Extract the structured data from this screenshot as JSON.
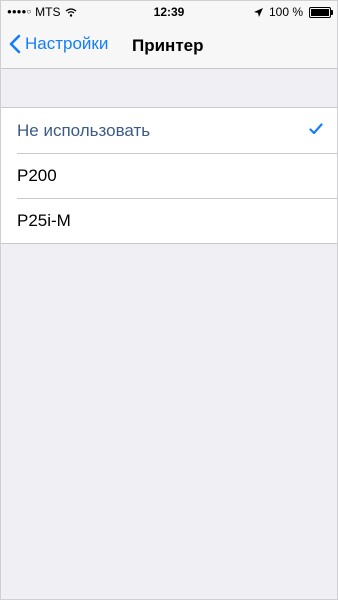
{
  "status_bar": {
    "carrier": "MTS",
    "time": "12:39",
    "battery_text": "100 %"
  },
  "nav": {
    "back_label": "Настройки",
    "title": "Принтер"
  },
  "printer_list": {
    "items": [
      {
        "label": "Не использовать",
        "selected": true
      },
      {
        "label": "P200",
        "selected": false
      },
      {
        "label": "P25i-M",
        "selected": false
      }
    ]
  },
  "colors": {
    "accent": "#147efb",
    "selected_text": "#3b5b85",
    "background": "#efeff4"
  },
  "icons": [
    "signal-dots-icon",
    "wifi-icon",
    "location-arrow-icon",
    "battery-icon",
    "back-chevron-icon",
    "checkmark-icon"
  ]
}
